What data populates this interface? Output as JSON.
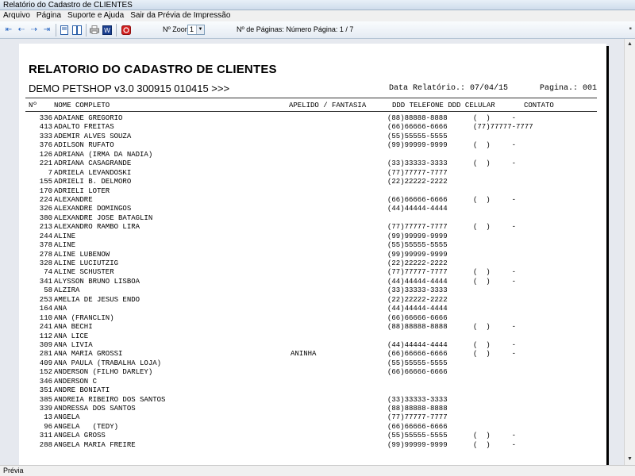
{
  "window": {
    "title": "Relatório do Cadastro de CLIENTES"
  },
  "menu": [
    "Arquivo",
    "Página",
    "Suporte e Ajuda",
    "Sair da Prévia de Impressão"
  ],
  "toolbar": {
    "zoom_label": "Nº Zoom",
    "zoom_value": "1",
    "pages_text": "Nº de Páginas: Número Página: 1 / 7",
    "icons": [
      "first-page-icon",
      "prev-page-icon",
      "next-page-icon",
      "last-page-icon",
      "single-page-icon",
      "two-pages-icon",
      "print-icon",
      "word-export-icon",
      "pdf-export-icon"
    ]
  },
  "report": {
    "title": "RELATORIO DO CADASTRO DE CLIENTES",
    "subtitle": "DEMO PETSHOP v3.0 300915 010415 >>>",
    "date_text": "Data Relatório.: 07/04/15",
    "page_text": "Pagina.: 001",
    "columns": {
      "num": "Nº",
      "name": "NOME COMPLETO",
      "apelido": "APELIDO / FANTASIA",
      "tel": "DDD TELEFONE DDD CELULAR",
      "contato": "CONTATO"
    },
    "rows": [
      {
        "id": "336",
        "name": "ADAIANE GREGORIO",
        "apelido": "",
        "tel": "(88)88888-8888",
        "cel": "(  )     -"
      },
      {
        "id": "413",
        "name": "ADALTO FREITAS",
        "apelido": "",
        "tel": "(66)66666-6666",
        "cel": "(77)77777-7777"
      },
      {
        "id": "333",
        "name": "ADEMIR ALVES SOUZA",
        "apelido": "",
        "tel": "(55)55555-5555",
        "cel": ""
      },
      {
        "id": "376",
        "name": "ADILSON RUFATO",
        "apelido": "",
        "tel": "(99)99999-9999",
        "cel": "(  )     -"
      },
      {
        "id": "126",
        "name": "ADRIANA (IRMA DA NADIA)",
        "apelido": "",
        "tel": "",
        "cel": ""
      },
      {
        "id": "221",
        "name": "ADRIANA CASAGRANDE",
        "apelido": "",
        "tel": "(33)33333-3333",
        "cel": "(  )     -"
      },
      {
        "id": "7",
        "name": "ADRIELA LEVANDOSKI",
        "apelido": "",
        "tel": "(77)77777-7777",
        "cel": ""
      },
      {
        "id": "155",
        "name": "ADRIELI B. DELMORO",
        "apelido": "",
        "tel": "(22)22222-2222",
        "cel": ""
      },
      {
        "id": "170",
        "name": "ADRIELI LOTER",
        "apelido": "",
        "tel": "",
        "cel": ""
      },
      {
        "id": "224",
        "name": "ALEXANDRE",
        "apelido": "",
        "tel": "(66)66666-6666",
        "cel": "(  )     -"
      },
      {
        "id": "326",
        "name": "ALEXANDRE DOMINGOS",
        "apelido": "",
        "tel": "(44)44444-4444",
        "cel": ""
      },
      {
        "id": "380",
        "name": "ALEXANDRE JOSE BATAGLIN",
        "apelido": "",
        "tel": "",
        "cel": ""
      },
      {
        "id": "213",
        "name": "ALEXANDRO RAMBO LIRA",
        "apelido": "",
        "tel": "(77)77777-7777",
        "cel": "(  )     -"
      },
      {
        "id": "244",
        "name": "ALINE",
        "apelido": "",
        "tel": "(99)99999-9999",
        "cel": ""
      },
      {
        "id": "378",
        "name": "ALINE",
        "apelido": "",
        "tel": "(55)55555-5555",
        "cel": ""
      },
      {
        "id": "278",
        "name": "ALINE LUBENOW",
        "apelido": "",
        "tel": "(99)99999-9999",
        "cel": ""
      },
      {
        "id": "328",
        "name": "ALINE LUCIUTZIG",
        "apelido": "",
        "tel": "(22)22222-2222",
        "cel": ""
      },
      {
        "id": "74",
        "name": "ALINE SCHUSTER",
        "apelido": "",
        "tel": "(77)77777-7777",
        "cel": "(  )     -"
      },
      {
        "id": "341",
        "name": "ALYSSON BRUNO LISBOA",
        "apelido": "",
        "tel": "(44)44444-4444",
        "cel": "(  )     -"
      },
      {
        "id": "58",
        "name": "ALZIRA",
        "apelido": "",
        "tel": "(33)33333-3333",
        "cel": ""
      },
      {
        "id": "253",
        "name": "AMELIA DE JESUS ENDO",
        "apelido": "",
        "tel": "(22)22222-2222",
        "cel": ""
      },
      {
        "id": "164",
        "name": "ANA",
        "apelido": "",
        "tel": "(44)44444-4444",
        "cel": ""
      },
      {
        "id": "110",
        "name": "ANA (FRANCLIN)",
        "apelido": "",
        "tel": "(66)66666-6666",
        "cel": ""
      },
      {
        "id": "241",
        "name": "ANA BECHI",
        "apelido": "",
        "tel": "(88)88888-8888",
        "cel": "(  )     -"
      },
      {
        "id": "112",
        "name": "ANA LICE",
        "apelido": "",
        "tel": "",
        "cel": ""
      },
      {
        "id": "309",
        "name": "ANA LIVIA",
        "apelido": "",
        "tel": "(44)44444-4444",
        "cel": "(  )     -"
      },
      {
        "id": "281",
        "name": "ANA MARIA GROSSI",
        "apelido": "ANINHA",
        "tel": "(66)66666-6666",
        "cel": "(  )     -"
      },
      {
        "id": "409",
        "name": "ANA PAULA (TRABALHA LOJA)",
        "apelido": "",
        "tel": "(55)55555-5555",
        "cel": ""
      },
      {
        "id": "152",
        "name": "ANDERSON (FILHO DARLEY)",
        "apelido": "",
        "tel": "(66)66666-6666",
        "cel": ""
      },
      {
        "id": "346",
        "name": "ANDERSON C",
        "apelido": "",
        "tel": "",
        "cel": ""
      },
      {
        "id": "351",
        "name": "ANDRE BONIATI",
        "apelido": "",
        "tel": "",
        "cel": ""
      },
      {
        "id": "385",
        "name": "ANDREIA RIBEIRO DOS SANTOS",
        "apelido": "",
        "tel": "(33)33333-3333",
        "cel": ""
      },
      {
        "id": "339",
        "name": "ANDRESSA DOS SANTOS",
        "apelido": "",
        "tel": "(88)88888-8888",
        "cel": ""
      },
      {
        "id": "13",
        "name": "ANGELA",
        "apelido": "",
        "tel": "(77)77777-7777",
        "cel": ""
      },
      {
        "id": "96",
        "name": "ANGELA   (TEDY)",
        "apelido": "",
        "tel": "(66)66666-6666",
        "cel": ""
      },
      {
        "id": "311",
        "name": "ANGELA GROSS",
        "apelido": "",
        "tel": "(55)55555-5555",
        "cel": "(  )     -"
      },
      {
        "id": "288",
        "name": "ANGELA MARIA FREIRE",
        "apelido": "",
        "tel": "(99)99999-9999",
        "cel": "(  )     -"
      }
    ]
  },
  "status": {
    "text": "Prévia"
  }
}
